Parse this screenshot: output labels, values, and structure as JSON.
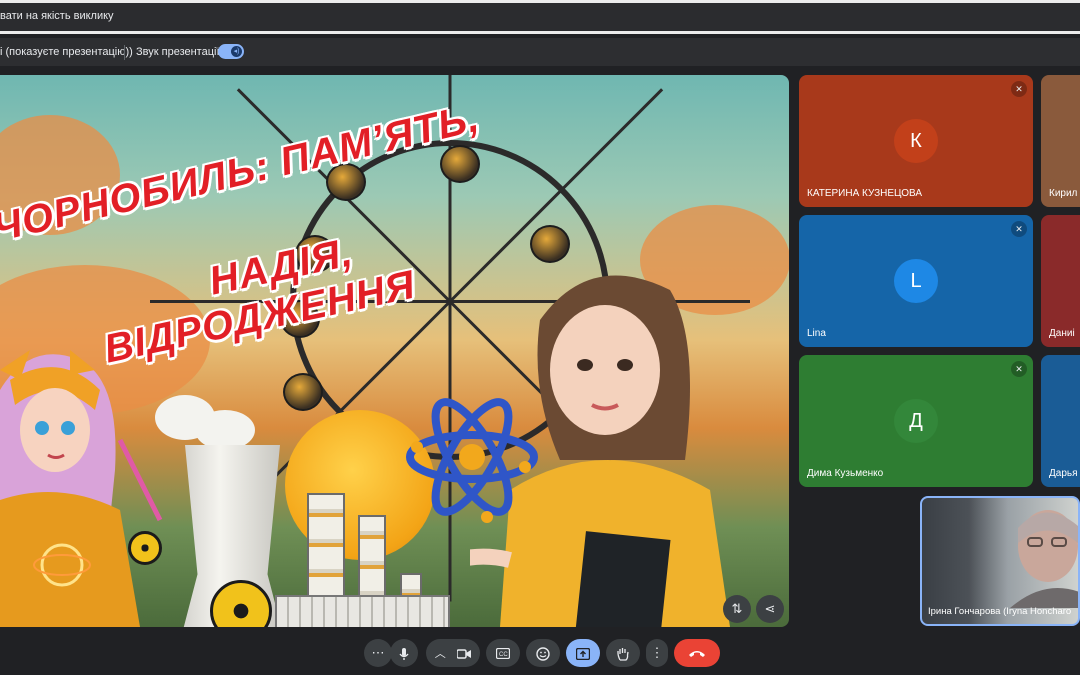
{
  "top_bar": {
    "feedback_text": "вати на якість виклику"
  },
  "presentation_bar": {
    "presenting_text": "і (показуєте презентацію))",
    "audio_label": "Звук презентації",
    "audio_on": true
  },
  "stage": {
    "title_line1": "ЧОРНОБИЛЬ: ПАМ’ЯТЬ,",
    "title_line2": "НАДІЯ,",
    "title_line3": "ВІДРОДЖЕННЯ",
    "pin_icon": "swap-icon",
    "share_icon": "share-icon"
  },
  "participants": [
    {
      "initial": "К",
      "name": "КАТЕРИНА КУЗНЕЦОВА",
      "tile_color": "#a8391b",
      "avatar_color": "#c2401a",
      "muted": true
    },
    {
      "initial": "",
      "name": "Кирил",
      "tile_color": "#8a5a3c",
      "avatar_color": "#9c6a48",
      "muted": false
    },
    {
      "initial": "L",
      "name": "Lina",
      "tile_color": "#1565a8",
      "avatar_color": "#1e88e5",
      "muted": true
    },
    {
      "initial": "",
      "name": "Даниі",
      "tile_color": "#8a2a2a",
      "avatar_color": "#a33030",
      "muted": false
    },
    {
      "initial": "Д",
      "name": "Дима Кузьменко",
      "tile_color": "#2e7d32",
      "avatar_color": "#33873a",
      "muted": true
    },
    {
      "initial": "",
      "name": "Дарья",
      "tile_color": "#1a5c96",
      "avatar_color": "#1e6cae",
      "muted": false
    }
  ],
  "self_view": {
    "name": "Ірина Гончарова (Iryna Honcharo"
  },
  "controls": {
    "more_options": "⋯",
    "mic_icon": "microphone-icon",
    "chevron_icon": "chevron-up-icon",
    "camera_icon": "camera-icon",
    "captions_icon": "captions-icon",
    "emoji_icon": "emoji-icon",
    "present_icon": "present-screen-icon",
    "hand_icon": "raise-hand-icon",
    "menu_icon": "vertical-dots-icon",
    "end_icon": "end-call-icon"
  }
}
